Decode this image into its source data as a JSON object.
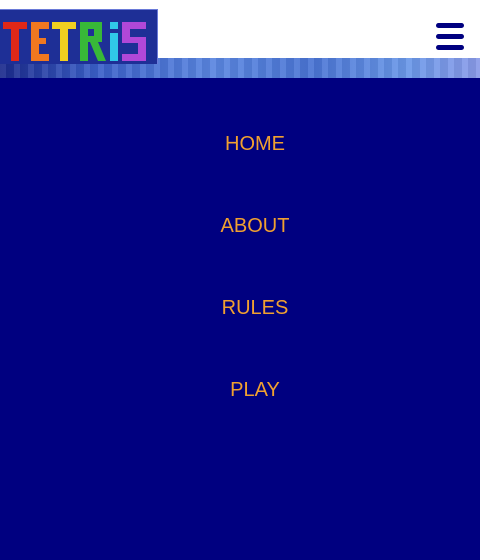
{
  "header": {
    "logo_text": "TETRiS",
    "menu_icon": "hamburger-menu-icon"
  },
  "nav": {
    "items": [
      {
        "label": "HOME"
      },
      {
        "label": "ABOUT"
      },
      {
        "label": "RULES"
      },
      {
        "label": "PLAY"
      }
    ]
  },
  "colors": {
    "background": "#000080",
    "header": "#ffffff",
    "nav_link": "#f0a030",
    "menu_icon": "#000080"
  }
}
